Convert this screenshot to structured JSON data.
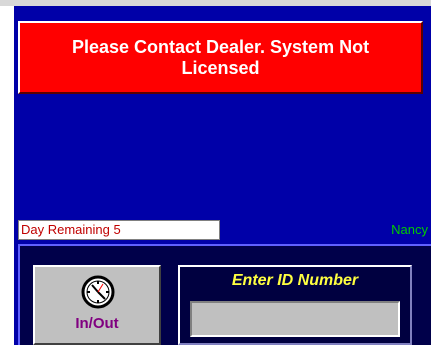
{
  "banner": {
    "message": "Please Contact Dealer. System Not\nLicensed"
  },
  "status": {
    "days_remaining": "Day Remaining 5",
    "user_name": "Nancy"
  },
  "clock_button": {
    "icon": "clock-icon",
    "label": "In/Out"
  },
  "id_entry": {
    "label": "Enter ID Number",
    "value": ""
  },
  "colors": {
    "panel_background": "#0000a8",
    "banner_background": "#ff0000",
    "banner_text": "#ffffff",
    "days_text": "#c00000",
    "user_name_text": "#00cc00",
    "inout_label_text": "#800080",
    "id_label_text": "#ffff40",
    "bottom_panel_background": "#00004a"
  }
}
